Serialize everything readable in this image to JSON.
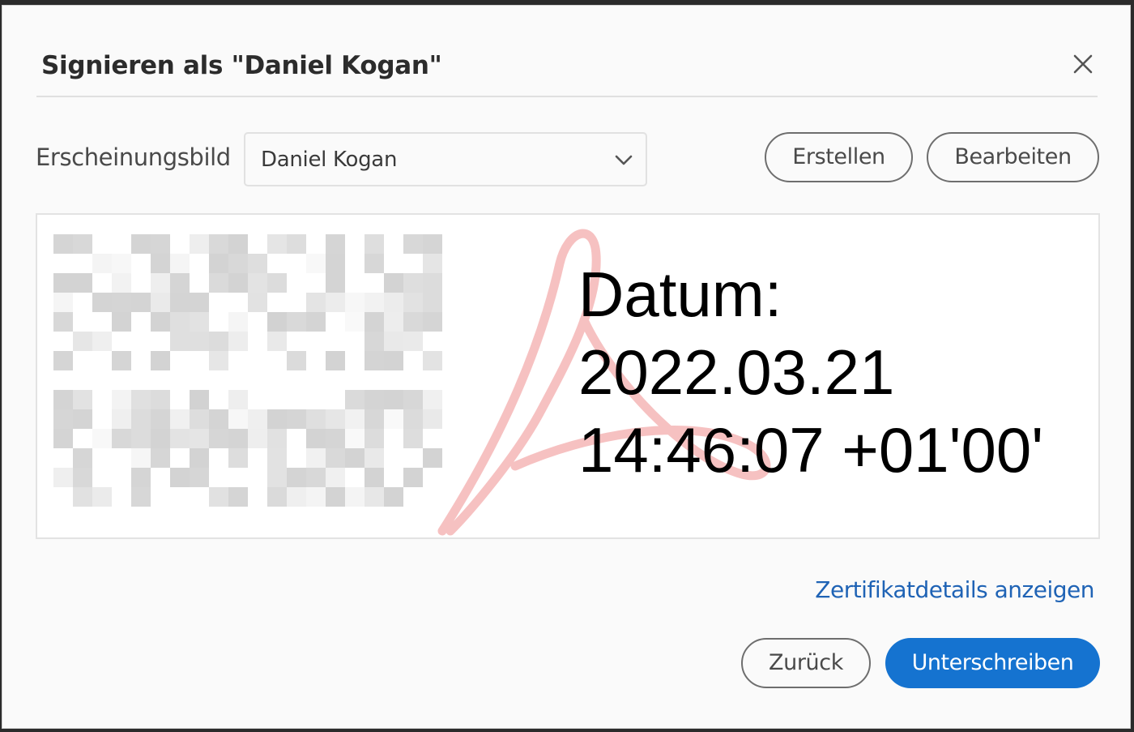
{
  "dialog": {
    "title": "Signieren als \"Daniel Kogan\"",
    "close_icon": "close-icon"
  },
  "appearance": {
    "label": "Erscheinungsbild",
    "selected": "Daniel Kogan",
    "chevron_icon": "chevron-down-icon",
    "create_label": "Erstellen",
    "edit_label": "Bearbeiten"
  },
  "preview": {
    "date_label": "Datum:",
    "date_value": "2022.03.21",
    "time_value": "14:46:07 +01'00'",
    "watermark": "adobe-acrobat-logo-watermark",
    "signature_name_pixelated": "Daniel Kogan"
  },
  "footer": {
    "cert_link": "Zertifikatdetails anzeigen",
    "back_label": "Zurück",
    "sign_label": "Unterschreiben"
  },
  "colors": {
    "accent": "#1573d0",
    "link": "#1f63b5",
    "watermark": "#f4b6b6"
  }
}
